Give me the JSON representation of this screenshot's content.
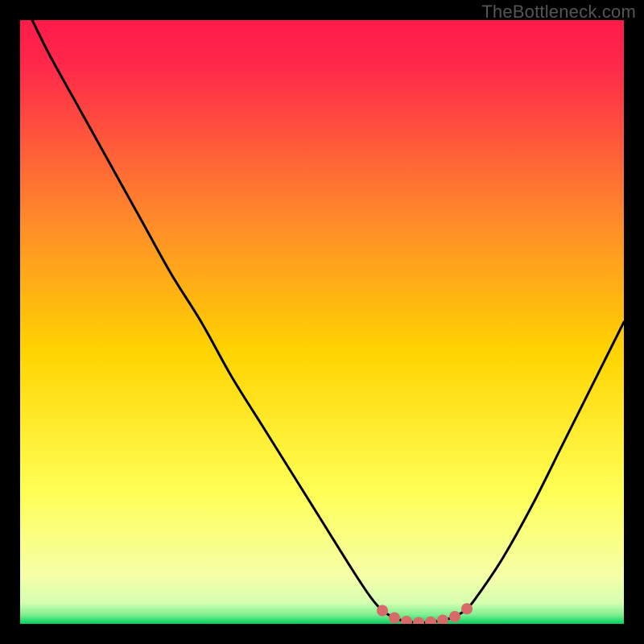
{
  "attribution": "TheBottleneck.com",
  "colors": {
    "top": "#ff1a4a",
    "mid_upper": "#ff8a2a",
    "mid": "#ffd400",
    "mid_lower": "#ffff55",
    "near_bottom": "#f6ffa8",
    "bottom": "#00d060",
    "curve": "#000000",
    "dots": "#d86a6a",
    "frame": "#000000"
  },
  "chart_data": {
    "type": "line",
    "title": "",
    "xlabel": "",
    "ylabel": "",
    "xlim": [
      0,
      100
    ],
    "ylim": [
      0,
      100
    ],
    "series": [
      {
        "name": "bottleneck-curve",
        "x": [
          2,
          5,
          10,
          15,
          20,
          25,
          30,
          35,
          40,
          45,
          50,
          55,
          58,
          60,
          62,
          64,
          66,
          68,
          70,
          72,
          74,
          76,
          80,
          85,
          90,
          95,
          100
        ],
        "y": [
          100,
          94,
          85,
          76,
          67,
          58,
          50,
          41,
          33,
          25,
          17,
          9,
          4.5,
          2.2,
          1.0,
          0.4,
          0.2,
          0.3,
          0.6,
          1.2,
          2.5,
          5,
          11,
          20,
          30,
          40,
          50
        ]
      }
    ],
    "markers": {
      "name": "flat-zone-dots",
      "x": [
        60,
        62,
        64,
        66,
        68,
        70,
        72,
        74
      ],
      "y": [
        2.2,
        1.0,
        0.4,
        0.2,
        0.3,
        0.6,
        1.2,
        2.5
      ]
    },
    "gradient_stops": [
      {
        "pos": 0.0,
        "color": "#ff1a4a"
      },
      {
        "pos": 0.08,
        "color": "#ff2a4a"
      },
      {
        "pos": 0.33,
        "color": "#ff8a2a"
      },
      {
        "pos": 0.55,
        "color": "#ffd400"
      },
      {
        "pos": 0.78,
        "color": "#ffff55"
      },
      {
        "pos": 0.92,
        "color": "#f6ffa8"
      },
      {
        "pos": 0.965,
        "color": "#d6ffb0"
      },
      {
        "pos": 0.985,
        "color": "#7ef090"
      },
      {
        "pos": 1.0,
        "color": "#00d060"
      }
    ]
  }
}
